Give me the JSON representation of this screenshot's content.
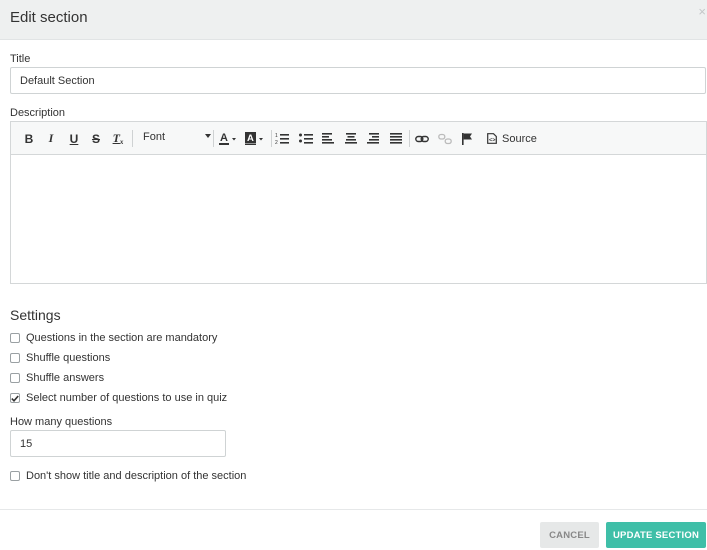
{
  "dialog": {
    "title": "Edit section",
    "close_glyph": "×"
  },
  "title_field": {
    "label": "Title",
    "value": "Default Section"
  },
  "description_field": {
    "label": "Description",
    "toolbar": {
      "bold": "B",
      "italic": "I",
      "underline": "U",
      "strike": "S",
      "remove_format": "T",
      "font_label": "Font",
      "source_label": "Source",
      "icons": [
        "bold-icon",
        "italic-icon",
        "underline-icon",
        "strikethrough-icon",
        "remove-format-icon",
        "text-color-icon",
        "background-color-icon",
        "numbered-list-icon",
        "bulleted-list-icon",
        "align-left-icon",
        "align-center-icon",
        "align-right-icon",
        "justify-icon",
        "link-icon",
        "unlink-icon",
        "anchor-flag-icon",
        "source-icon"
      ]
    },
    "content": ""
  },
  "settings": {
    "title": "Settings",
    "options": [
      {
        "label": "Questions in the section are mandatory",
        "checked": false
      },
      {
        "label": "Shuffle questions",
        "checked": false
      },
      {
        "label": "Shuffle answers",
        "checked": false
      },
      {
        "label": "Select number of questions to use in quiz",
        "checked": true
      }
    ],
    "how_many": {
      "label": "How many questions",
      "value": "15"
    },
    "hide_option": {
      "label": "Don't show title and description of the section",
      "checked": false
    }
  },
  "footer": {
    "cancel_label": "CANCEL",
    "update_label": "UPDATE SECTION"
  },
  "colors": {
    "header_bg": "#eef0f0",
    "accent": "#3fbfa8",
    "cancel_bg": "#e6e8e8"
  }
}
